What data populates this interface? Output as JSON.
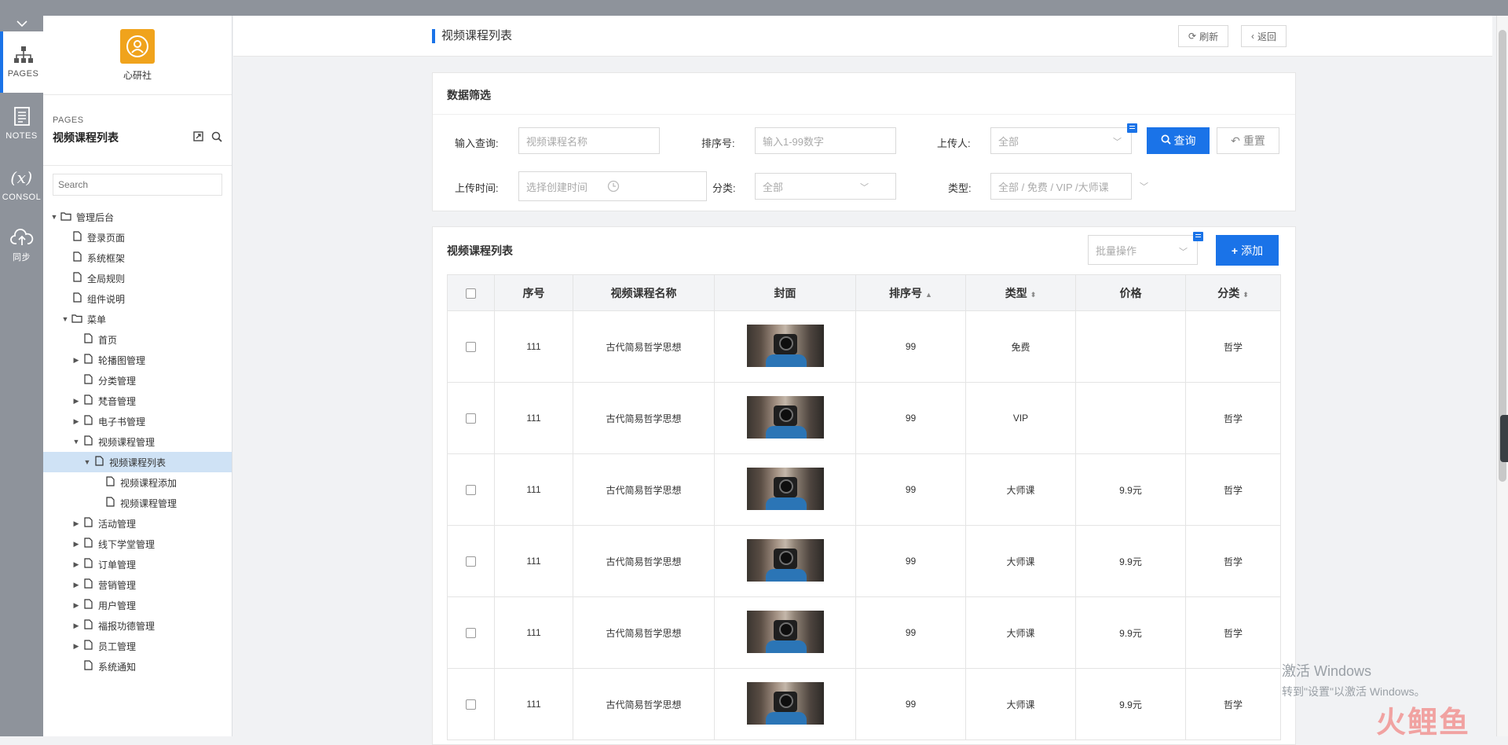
{
  "rail": {
    "items": [
      {
        "label": "PAGES",
        "icon": "sitemap-icon"
      },
      {
        "label": "NOTES",
        "icon": "notes-icon"
      },
      {
        "label": "CONSOL",
        "icon": "variable-icon"
      },
      {
        "label": "同步",
        "icon": "cloud-upload-icon"
      }
    ]
  },
  "panel": {
    "logo_name": "心研社",
    "subtitle": "PAGES",
    "title": "视频课程列表",
    "search_placeholder": "Search",
    "tree": [
      {
        "label": "管理后台",
        "type": "folder",
        "arrow": "down",
        "level": 0
      },
      {
        "label": "登录页面",
        "type": "page",
        "arrow": "",
        "level": 1
      },
      {
        "label": "系统框架",
        "type": "page",
        "arrow": "",
        "level": 1
      },
      {
        "label": "全局规则",
        "type": "page",
        "arrow": "",
        "level": 1
      },
      {
        "label": "组件说明",
        "type": "page",
        "arrow": "",
        "level": 1
      },
      {
        "label": "菜单",
        "type": "folder",
        "arrow": "down",
        "level": 1
      },
      {
        "label": "首页",
        "type": "page",
        "arrow": "",
        "level": 2
      },
      {
        "label": "轮播图管理",
        "type": "page",
        "arrow": "right",
        "level": 2
      },
      {
        "label": "分类管理",
        "type": "page",
        "arrow": "",
        "level": 2
      },
      {
        "label": "梵音管理",
        "type": "page",
        "arrow": "right",
        "level": 2
      },
      {
        "label": "电子书管理",
        "type": "page",
        "arrow": "right",
        "level": 2
      },
      {
        "label": "视频课程管理",
        "type": "page",
        "arrow": "down",
        "level": 2
      },
      {
        "label": "视频课程列表",
        "type": "page",
        "arrow": "down",
        "level": 3,
        "selected": true
      },
      {
        "label": "视频课程添加",
        "type": "page",
        "arrow": "",
        "level": 4
      },
      {
        "label": "视频课程管理",
        "type": "page",
        "arrow": "",
        "level": 4
      },
      {
        "label": "活动管理",
        "type": "page",
        "arrow": "right",
        "level": 2
      },
      {
        "label": "线下学堂管理",
        "type": "page",
        "arrow": "right",
        "level": 2
      },
      {
        "label": "订单管理",
        "type": "page",
        "arrow": "right",
        "level": 2
      },
      {
        "label": "营销管理",
        "type": "page",
        "arrow": "right",
        "level": 2
      },
      {
        "label": "用户管理",
        "type": "page",
        "arrow": "right",
        "level": 2
      },
      {
        "label": "福报功德管理",
        "type": "page",
        "arrow": "right",
        "level": 2
      },
      {
        "label": "员工管理",
        "type": "page",
        "arrow": "right",
        "level": 2
      },
      {
        "label": "系统通知",
        "type": "page",
        "arrow": "",
        "level": 2
      }
    ]
  },
  "header": {
    "title": "视频课程列表",
    "refresh_label": "刷新",
    "back_label": "返回"
  },
  "filter": {
    "title": "数据筛选",
    "keyword_label": "输入查询:",
    "keyword_placeholder": "视频课程名称",
    "sort_label": "排序号:",
    "sort_placeholder": "输入1-99数字",
    "uploader_label": "上传人:",
    "uploader_value": "全部",
    "time_label": "上传时间:",
    "time_placeholder": "选择创建时间",
    "category_label": "分类:",
    "category_value": "全部",
    "type_label": "类型:",
    "type_value": "全部 / 免费 / VIP /大师课",
    "query_label": "查询",
    "reset_label": "重置"
  },
  "list": {
    "title": "视频课程列表",
    "batch_placeholder": "批量操作",
    "add_label": "添加",
    "columns": [
      "序号",
      "视频课程名称",
      "封面",
      "排序号",
      "类型",
      "价格",
      "分类"
    ],
    "rows": [
      {
        "id": "111",
        "name": "古代简易哲学思想",
        "sort": "99",
        "type": "免费",
        "price": "",
        "category": "哲学"
      },
      {
        "id": "111",
        "name": "古代简易哲学思想",
        "sort": "99",
        "type": "VIP",
        "price": "",
        "category": "哲学"
      },
      {
        "id": "111",
        "name": "古代简易哲学思想",
        "sort": "99",
        "type": "大师课",
        "price": "9.9元",
        "category": "哲学"
      },
      {
        "id": "111",
        "name": "古代简易哲学思想",
        "sort": "99",
        "type": "大师课",
        "price": "9.9元",
        "category": "哲学"
      },
      {
        "id": "111",
        "name": "古代简易哲学思想",
        "sort": "99",
        "type": "大师课",
        "price": "9.9元",
        "category": "哲学"
      },
      {
        "id": "111",
        "name": "古代简易哲学思想",
        "sort": "99",
        "type": "大师课",
        "price": "9.9元",
        "category": "哲学"
      }
    ]
  },
  "watermark": {
    "windows_line1": "激活 Windows",
    "windows_line2": "转到\"设置\"以激活 Windows。",
    "brand": "火鲤鱼"
  },
  "colors": {
    "accent": "#1a73e8",
    "logo": "#f0a31c",
    "rail": "#8e939b"
  }
}
